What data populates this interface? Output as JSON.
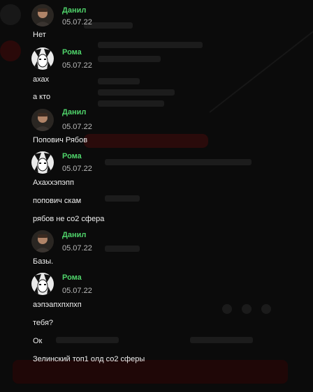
{
  "messages": [
    {
      "kind": "header",
      "user": "Данил",
      "date": "05.07.22"
    },
    {
      "kind": "text",
      "text": "Нет"
    },
    {
      "kind": "header",
      "user": "Рома",
      "date": "05.07.22"
    },
    {
      "kind": "text",
      "text": "ахах"
    },
    {
      "kind": "text",
      "text": "а кто"
    },
    {
      "kind": "header",
      "user": "Данил",
      "date": "05.07.22"
    },
    {
      "kind": "text",
      "text": "Попович Рябов"
    },
    {
      "kind": "header",
      "user": "Рома",
      "date": "05.07.22"
    },
    {
      "kind": "text",
      "text": "Ахаххэпэпп"
    },
    {
      "kind": "text",
      "text": "попович скам"
    },
    {
      "kind": "text",
      "text": "рябов не со2 сфера"
    },
    {
      "kind": "header",
      "user": "Данил",
      "date": "05.07.22"
    },
    {
      "kind": "text",
      "text": "Базы."
    },
    {
      "kind": "header",
      "user": "Рома",
      "date": "05.07.22"
    },
    {
      "kind": "text",
      "text": "аэпэапхпхпхп"
    },
    {
      "kind": "text",
      "text": "тебя?"
    },
    {
      "kind": "text",
      "text": "Ок"
    },
    {
      "kind": "text",
      "text": "Зелинский топ1 олд со2 сферы"
    }
  ],
  "colors": {
    "background": "#0b0b0b",
    "username": "#4fd36a",
    "date": "#b9b9b9",
    "message_text": "#f0f0f0",
    "faded_red": "#3a0d0d"
  },
  "icons": {
    "Данил": "user-photo-avatar",
    "Рома": "bw-anime-avatar"
  }
}
